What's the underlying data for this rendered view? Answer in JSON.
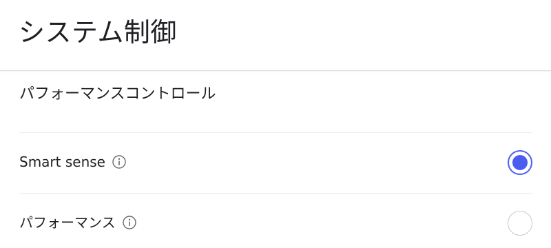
{
  "header": {
    "title": "システム制御"
  },
  "section": {
    "title": "パフォーマンスコントロール"
  },
  "options": [
    {
      "label": "Smart sense",
      "selected": true,
      "icon": "info-icon"
    },
    {
      "label": "パフォーマンス",
      "selected": false,
      "icon": "info-icon"
    }
  ],
  "colors": {
    "accent": "#4a5df0",
    "text": "#1f1f24",
    "divider": "#ececec",
    "radio_border": "#c8c8c8"
  }
}
